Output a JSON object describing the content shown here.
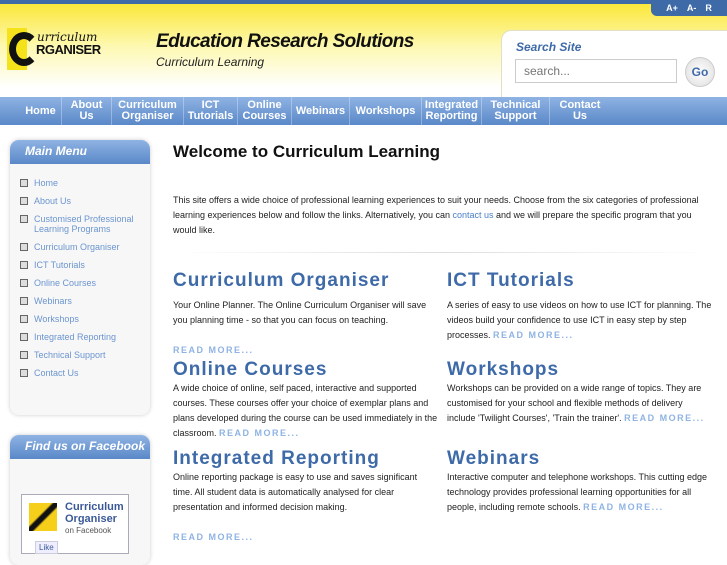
{
  "font_controls": [
    "A+",
    "A-",
    "R"
  ],
  "logo": {
    "line1": "urriculum",
    "line2": "RGANISER"
  },
  "header": {
    "title": "Education Research Solutions",
    "subtitle": "Curriculum Learning"
  },
  "search": {
    "label": "Search Site",
    "placeholder": "search...",
    "button": "Go"
  },
  "nav": [
    "Home",
    "About Us",
    "Curriculum Organiser",
    "ICT Tutorials",
    "Online Courses",
    "Webinars",
    "Workshops",
    "Integrated Reporting",
    "Technical Support",
    "Contact Us"
  ],
  "sidebar": {
    "title": "Main Menu",
    "items": [
      "Home",
      "About Us",
      "Customised Professional Learning Programs",
      "Curriculum Organiser",
      "ICT Tutorials",
      "Online Courses",
      "Webinars",
      "Workshops",
      "Integrated Reporting",
      "Technical Support",
      "Contact Us"
    ]
  },
  "facebook": {
    "title": "Find us on Facebook",
    "name": "Curriculum Organiser",
    "sub": "on Facebook",
    "like": "Like"
  },
  "main": {
    "title": "Welcome to Curriculum Learning",
    "intro_pre": "This site offers a wide choice of professional learning experiences to suit your needs. Choose from the six categories of professional learning experiences below and follow the links.  Alternatively, you can ",
    "intro_link": "contact us",
    "intro_post": " and we will prepare the specific program that you would like.",
    "read_more": "READ MORE...",
    "cards": [
      {
        "title": "Curriculum Organiser",
        "text": "Your Online Planner. The Online Curriculum Organiser will save you planning time - so that you can focus on teaching."
      },
      {
        "title": "ICT Tutorials",
        "text": "A series of easy to use videos on how to use ICT for planning. The videos build your confidence to use ICT in easy step by step processes."
      },
      {
        "title": "Online Courses",
        "text": "A wide choice of online, self paced, interactive and supported courses. These courses offer your choice of exemplar plans and plans developed during the course can be used immediately in the classroom."
      },
      {
        "title": "Workshops",
        "text": "Workshops can be provided on a wide range of topics. They  are customised for your school and flexible methods of delivery include 'Twilight Courses', 'Train the trainer'."
      },
      {
        "title": "Integrated Reporting",
        "text": "Online reporting package is easy to use and saves significant time. All student data is automatically analysed for clear presentation and informed decision making."
      },
      {
        "title": "Webinars",
        "text": "Interactive computer and telephone workshops. This cutting edge technology provides professional learning opportunities for all people, including remote schools."
      }
    ]
  }
}
